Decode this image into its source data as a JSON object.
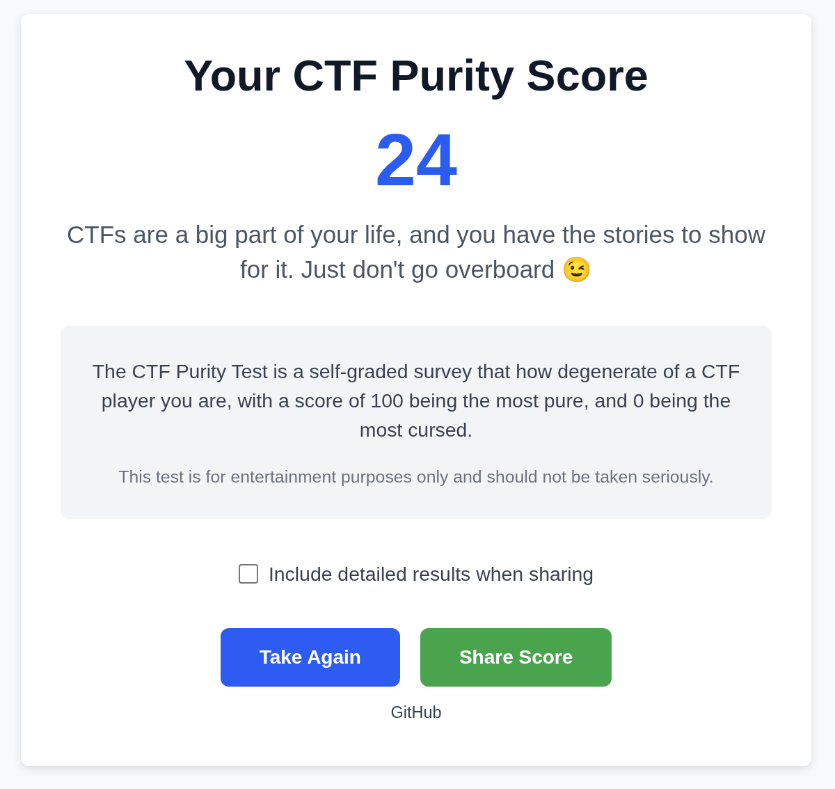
{
  "title": "Your CTF Purity Score",
  "score": "24",
  "message": "CTFs are a big part of your life, and you have the stories to show for it. Just don't go overboard 😉",
  "info": {
    "description": "The CTF Purity Test is a self-graded survey that how degenerate of a CTF player you are, with a score of 100 being the most pure, and 0 being the most cursed.",
    "disclaimer": "This test is for entertainment purposes only and should not be taken seriously."
  },
  "share_option": {
    "label": "Include detailed results when sharing",
    "checked": false
  },
  "buttons": [
    {
      "label": "Take Again",
      "kind": "primary"
    },
    {
      "label": "Share Score",
      "kind": "success"
    }
  ],
  "footer_link": "GitHub"
}
